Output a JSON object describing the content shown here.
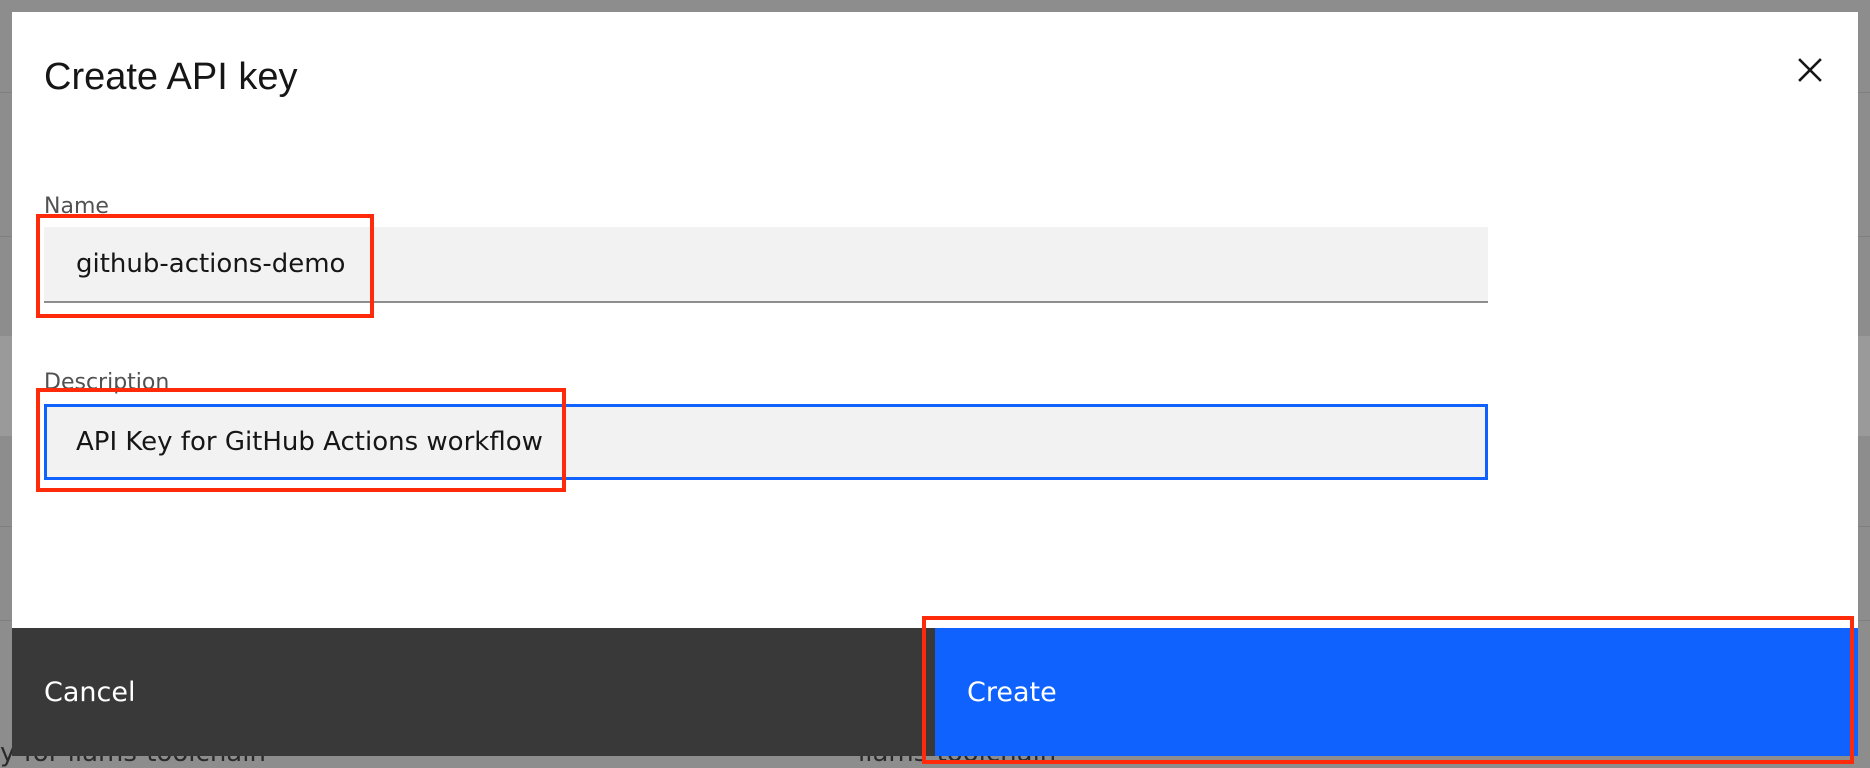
{
  "modal": {
    "title": "Create API key",
    "close_icon": "close-icon"
  },
  "form": {
    "name": {
      "label": "Name",
      "value": "github-actions-demo"
    },
    "description": {
      "label": "Description",
      "value": "API Key for GitHub Actions workflow"
    }
  },
  "footer": {
    "cancel_label": "Cancel",
    "create_label": "Create"
  },
  "background": {
    "row_text_left": "y for liams-toolchain",
    "row_text_right": "liams-toolchain"
  },
  "colors": {
    "primary": "#0f62fe",
    "secondary": "#393939",
    "highlight": "#ff2a0a",
    "field_background": "#f2f2f2"
  }
}
